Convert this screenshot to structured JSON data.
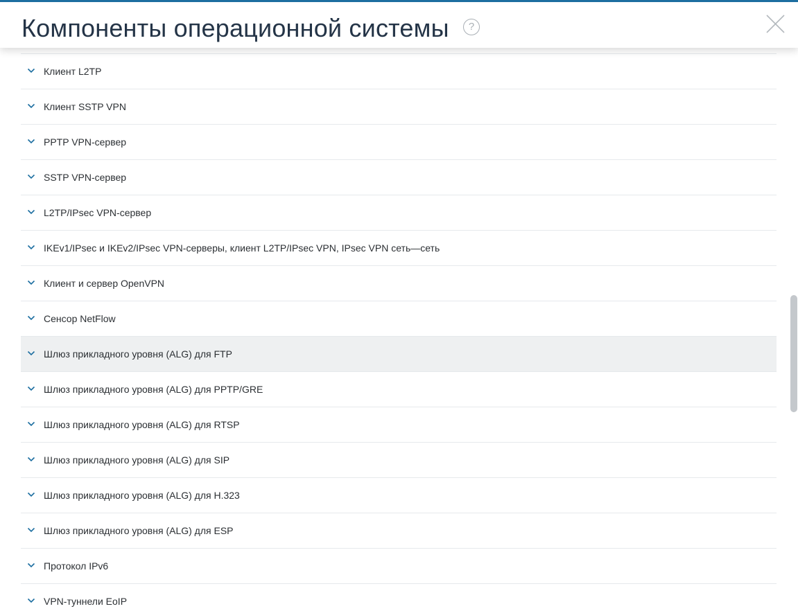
{
  "header": {
    "title": "Компоненты операционной системы",
    "help_symbol": "?"
  },
  "colors": {
    "accent": "#1c6ea0",
    "chevron": "#1c6ea0",
    "row_highlight": "#eef0f1"
  },
  "icons": {
    "help": "question-circle-icon",
    "close": "close-icon",
    "row": "chevron-down-icon"
  },
  "components": [
    {
      "label": "Клиент L2TP"
    },
    {
      "label": "Клиент SSTP VPN"
    },
    {
      "label": "PPTP VPN-сервер"
    },
    {
      "label": "SSTP VPN-сервер"
    },
    {
      "label": "L2TP/IPsec VPN-сервер"
    },
    {
      "label": "IKEv1/IPsec и IKEv2/IPsec VPN-серверы, клиент L2TP/IPsec VPN, IPsec VPN сеть—сеть"
    },
    {
      "label": "Клиент и сервер OpenVPN"
    },
    {
      "label": "Сенсор NetFlow"
    },
    {
      "label": "Шлюз прикладного уровня (ALG) для FTP",
      "highlighted": true
    },
    {
      "label": "Шлюз прикладного уровня (ALG) для PPTP/GRE"
    },
    {
      "label": "Шлюз прикладного уровня (ALG) для RTSP"
    },
    {
      "label": "Шлюз прикладного уровня (ALG) для SIP"
    },
    {
      "label": "Шлюз прикладного уровня (ALG) для H.323"
    },
    {
      "label": "Шлюз прикладного уровня (ALG) для ESP"
    },
    {
      "label": "Протокол IPv6"
    },
    {
      "label": "VPN-туннели EoIP"
    }
  ]
}
